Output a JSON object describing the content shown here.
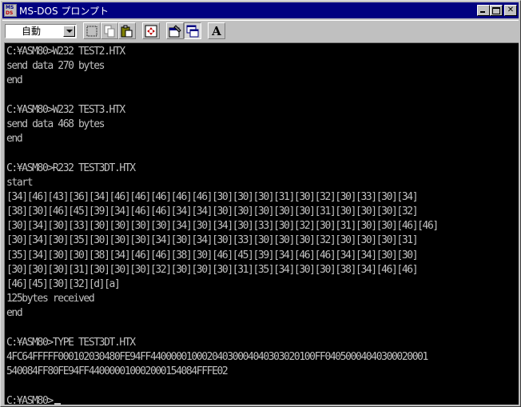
{
  "window": {
    "title": "MS-DOS プロンプト",
    "icon": "msdos-icon"
  },
  "toolbar": {
    "font_size_value": "自動",
    "buttons": [
      "mark-icon",
      "copy-icon",
      "paste-icon",
      "fullscreen-icon",
      "properties-icon",
      "background-icon",
      "font-icon"
    ],
    "font_button_label": "A"
  },
  "console": {
    "lines": [
      "C:¥ASM80>W232 TEST2.HTX",
      "send data 270 bytes",
      "end",
      "",
      "C:¥ASM80>W232 TEST3.HTX",
      "send data 468 bytes",
      "end",
      "",
      "C:¥ASM80>R232 TEST3DT.HTX",
      "start",
      "[34][46][43][36][34][46][46][46][46][46][30][30][30][31][30][32][30][33][30][34]",
      "[38][30][46][45][39][34][46][46][34][34][30][30][30][30][30][31][30][30][30][32]",
      "[30][34][30][33][30][30][30][30][34][30][34][30][33][30][32][30][31][30][30][46][46]",
      "[30][34][30][35][30][30][30][34][30][34][30][33][30][30][30][32][30][30][30][31]",
      "[35][34][30][30][38][34][46][46][38][30][46][45][39][34][46][46][34][34][30][30]",
      "[30][30][30][31][30][30][30][32][30][30][30][31][35][34][30][30][38][34][46][46]",
      "[46][45][30][32][d][a]",
      "125bytes received",
      "end",
      "",
      "C:¥ASM80>TYPE TEST3DT.HTX",
      "4FC64FFFFF000102030480FE94FF44000001000204030004040303020100FF04050004040300020001",
      "540084FF80FE94FF440000010002000154084FFFE02",
      "",
      "C:¥ASM80>"
    ]
  },
  "colors": {
    "titlebar": "#000080",
    "console_bg": "#000000",
    "console_text": "#c0c0c0",
    "chrome": "#c0c0c0"
  }
}
